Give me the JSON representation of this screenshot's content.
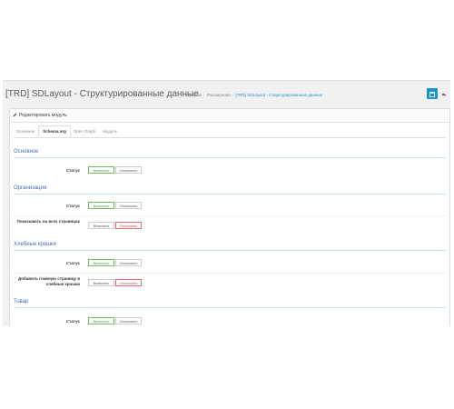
{
  "header": {
    "title": "[TRD] SDLayout - Структурированные данные",
    "breadcrumbs": [
      "Главная",
      "Расширения",
      "[TRD] SDLayout - Структурированные данные"
    ],
    "save_icon": "save-icon",
    "back_icon": "reply-icon"
  },
  "panel": {
    "title": "Редактировать модуль",
    "tabs": [
      "Основное",
      "Schema.org",
      "Open Graph",
      "Модуль"
    ],
    "active_tab": "Schema.org"
  },
  "sections": {
    "main": "Основное",
    "org": "Организация",
    "breadcrumbs": "Хлебные крошки",
    "product": "Товар"
  },
  "rows": {
    "main_status": "Статус",
    "org_status": "Статус",
    "org_all_pages": "Показывать на всех страницах",
    "bc_status": "Статус",
    "bc_add_home": "Добавить главную страницу в хлебные крошки",
    "product_status": "Статус"
  },
  "toggle": {
    "on": "Включено",
    "off": "Отключено"
  },
  "colors": {
    "accent": "#1e91cf",
    "on": "#6fba5c",
    "off": "#e06b6b"
  }
}
